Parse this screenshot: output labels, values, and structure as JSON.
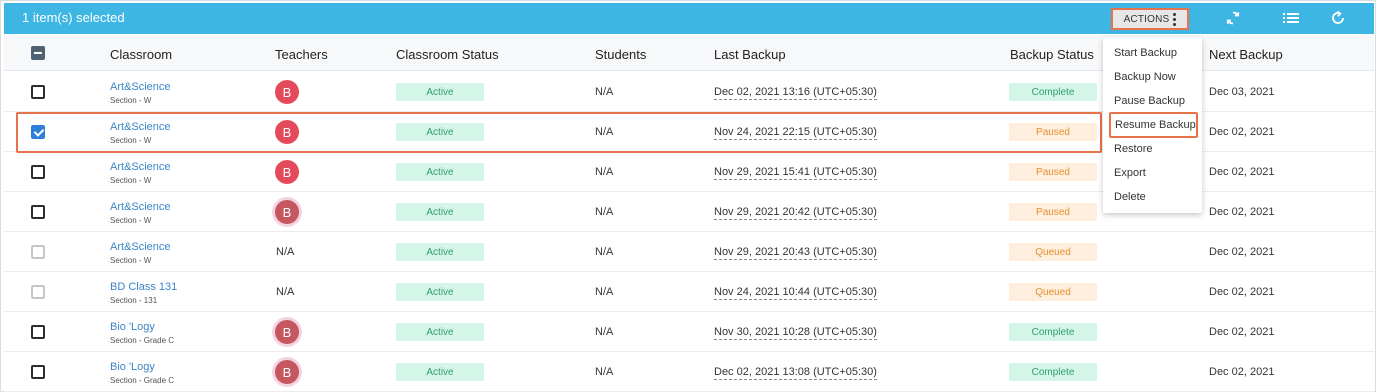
{
  "toolbar": {
    "selection_text": "1 item(s) selected",
    "actions_label": "ACTIONS",
    "icons": [
      "sync-icon",
      "list-icon",
      "refresh-icon"
    ],
    "bar_color": "#3db6e4"
  },
  "table": {
    "columns": [
      "Classroom",
      "Teachers",
      "Classroom Status",
      "Students",
      "Last Backup",
      "Backup Status",
      "Next Backup"
    ],
    "rows": [
      {
        "name": "Art&Science",
        "section": "Section - W",
        "teacher": "B",
        "class_status": "Active",
        "students": "N/A",
        "last_backup": "Dec 02, 2021 13:16 (UTC+05:30)",
        "backup_status": "Complete",
        "next_backup": "Dec 03, 2021"
      },
      {
        "name": "Art&Science",
        "section": "Section - W",
        "teacher": "B",
        "class_status": "Active",
        "students": "N/A",
        "last_backup": "Nov 24, 2021 22:15 (UTC+05:30)",
        "backup_status": "Paused",
        "next_backup": "Dec 02, 2021"
      },
      {
        "name": "Art&Science",
        "section": "Section - W",
        "teacher": "B",
        "class_status": "Active",
        "students": "N/A",
        "last_backup": "Nov 29, 2021 15:41 (UTC+05:30)",
        "backup_status": "Paused",
        "next_backup": "Dec 02, 2021"
      },
      {
        "name": "Art&Science",
        "section": "Section - W",
        "teacher": "B",
        "class_status": "Active",
        "students": "N/A",
        "last_backup": "Nov 29, 2021 20:42 (UTC+05:30)",
        "backup_status": "Paused",
        "next_backup": "Dec 02, 2021"
      },
      {
        "name": "Art&Science",
        "section": "Section - W",
        "teacher": "N/A",
        "class_status": "Active",
        "students": "N/A",
        "last_backup": "Nov 29, 2021 20:43 (UTC+05:30)",
        "backup_status": "Queued",
        "next_backup": "Dec 02, 2021"
      },
      {
        "name": "BD Class 131",
        "section": "Section - 131",
        "teacher": "N/A",
        "class_status": "Active",
        "students": "N/A",
        "last_backup": "Nov 24, 2021 10:44 (UTC+05:30)",
        "backup_status": "Queued",
        "next_backup": "Dec 02, 2021"
      },
      {
        "name": "Bio 'Logy",
        "section": "Section - Grade C",
        "teacher": "B",
        "class_status": "Active",
        "students": "N/A",
        "last_backup": "Nov 30, 2021 10:28 (UTC+05:30)",
        "backup_status": "Complete",
        "next_backup": "Dec 02, 2021"
      },
      {
        "name": "Bio 'Logy",
        "section": "Section - Grade C",
        "teacher": "B",
        "class_status": "Active",
        "students": "N/A",
        "last_backup": "Dec 02, 2021 13:08 (UTC+05:30)",
        "backup_status": "Complete",
        "next_backup": "Dec 02, 2021"
      }
    ]
  },
  "actions_menu": {
    "items": [
      "Start Backup",
      "Backup Now",
      "Pause Backup",
      "Resume Backup",
      "Restore",
      "Export",
      "Delete"
    ]
  },
  "colors": {
    "highlight_outline": "#e8734a",
    "status_complete": "#2f9e6e",
    "status_paused": "#e8912f",
    "link": "#3b86c9"
  }
}
